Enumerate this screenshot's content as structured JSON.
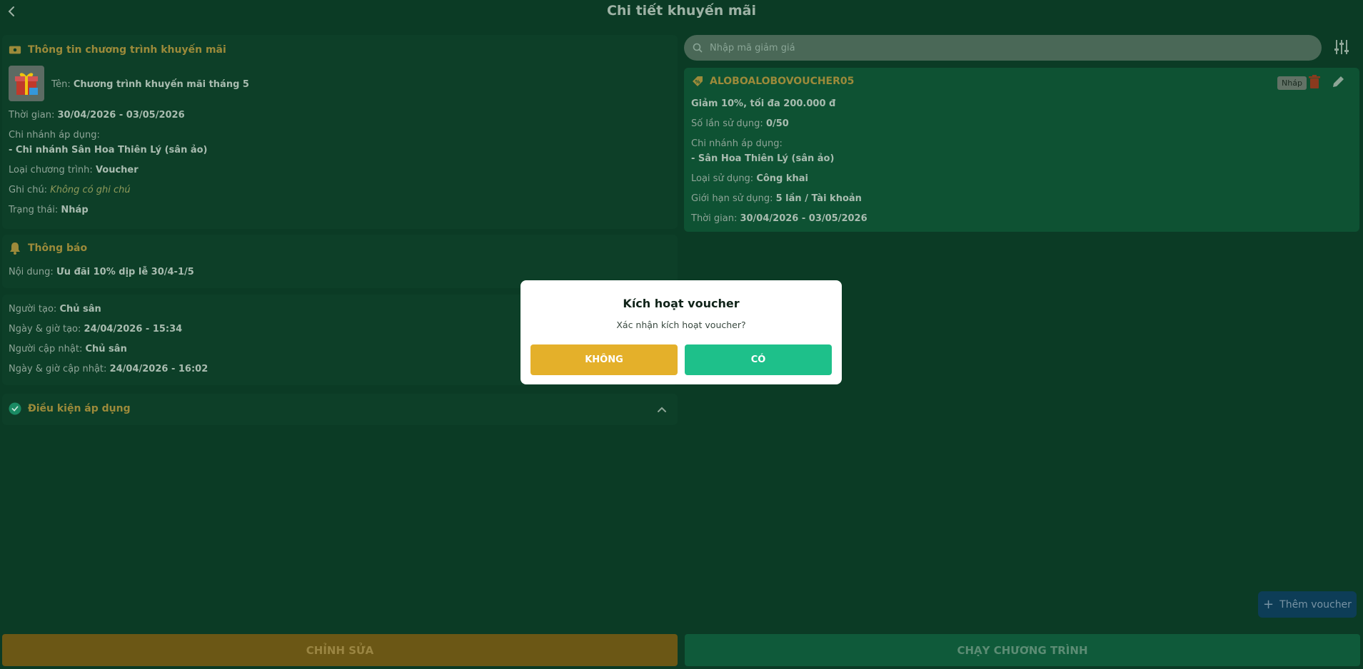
{
  "header": {
    "title": "Chi tiết khuyến mãi"
  },
  "promo": {
    "section_title": "Thông tin chương trình khuyến mãi",
    "name_label": "Tên:",
    "name_value": "Chương trình khuyến mãi tháng 5",
    "time_label": "Thời gian:",
    "time_value": "30/04/2026 - 03/05/2026",
    "branch_label": "Chi nhánh áp dụng:",
    "branch_value": "- Chi nhánh Sân Hoa Thiên Lý (sân ảo)",
    "type_label": "Loại chương trình:",
    "type_value": "Voucher",
    "note_label": "Ghi chú:",
    "note_value": "Không có ghi chú",
    "status_label": "Trạng thái:",
    "status_value": "Nháp"
  },
  "notification": {
    "section_title": "Thông báo",
    "content_label": "Nội dung:",
    "content_value": "Ưu đãi 10% dịp lễ 30/4-1/5"
  },
  "audit": {
    "creator_label": "Người tạo:",
    "creator_value": "Chủ sân",
    "created_label": "Ngày & giờ tạo:",
    "created_value": "24/04/2026 - 15:34",
    "updater_label": "Người cập nhật:",
    "updater_value": "Chủ sân",
    "updated_label": "Ngày & giờ cập nhật:",
    "updated_value": "24/04/2026 - 16:02"
  },
  "conditions": {
    "section_title": "Điều kiện áp dụng"
  },
  "search": {
    "placeholder": "Nhập mã giảm giá"
  },
  "voucher": {
    "code": "ALOBOALOBOVOUCHER05",
    "badge": "Nháp",
    "discount": "Giảm 10%, tối đa 200.000 đ",
    "usage_label": "Số lần sử dụng:",
    "usage_value": "0/50",
    "branch_label": "Chi nhánh áp dụng:",
    "branch_value": "- Sân Hoa Thiên Lý (sân ảo)",
    "use_type_label": "Loại sử dụng:",
    "use_type_value": "Công khai",
    "limit_label": "Giới hạn sử dụng:",
    "limit_value": "5 lần / Tài khoản",
    "time_label": "Thời gian:",
    "time_value": "30/04/2026 - 03/05/2026"
  },
  "add_voucher_label": "Thêm voucher",
  "footer": {
    "edit_label": "CHỈNH SỬA",
    "run_label": "CHẠY CHƯƠNG TRÌNH"
  },
  "modal": {
    "title": "Kích hoạt voucher",
    "message": "Xác nhận kích hoạt voucher?",
    "no_label": "KHÔNG",
    "yes_label": "CÓ"
  },
  "colors": {
    "accent_gold": "#e4b02a",
    "accent_green": "#1ec08a",
    "background": "#0b3b25"
  }
}
